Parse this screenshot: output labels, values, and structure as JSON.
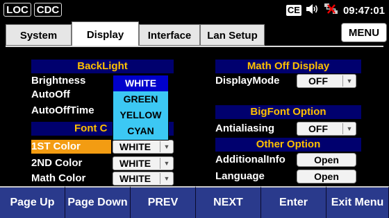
{
  "status": {
    "loc": "LOC",
    "cdc": "CDC",
    "ce_label": "CE",
    "time": "09:47:01",
    "icons": [
      "ce-indicator-icon",
      "speaker-icon",
      "lan-disconnected-icon"
    ]
  },
  "tabs": [
    {
      "label": "System"
    },
    {
      "label": "Display"
    },
    {
      "label": "Interface"
    },
    {
      "label": "Lan Setup"
    }
  ],
  "menu_label": "MENU",
  "left": {
    "backlight_header": "BackLight",
    "brightness_label": "Brightness",
    "autooff_label": "AutoOff",
    "autoofftime_label": "AutoOffTime",
    "font_color_header": "Font Color",
    "font_color_header_visible": "Font C",
    "first_color_label": "1ST Color",
    "first_color_value": "WHITE",
    "second_color_label": "2ND Color",
    "second_color_value": "WHITE",
    "math_color_label": "Math Color",
    "math_color_value": "WHITE"
  },
  "dropdown": {
    "options": [
      "WHITE",
      "GREEN",
      "YELLOW",
      "CYAN"
    ],
    "selected": "WHITE"
  },
  "right": {
    "math_off_header": "Math Off Display",
    "display_mode_label": "DisplayMode",
    "display_mode_value": "OFF",
    "bigfont_header": "BigFont Option",
    "antialiasing_label": "Antialiasing",
    "antialiasing_value": "OFF",
    "other_header": "Other Option",
    "additional_label": "AdditionalInfo",
    "additional_button": "Open",
    "language_label": "Language",
    "language_button": "Open"
  },
  "softkeys": [
    "Page Up",
    "Page Down",
    "PREV",
    "NEXT",
    "Enter",
    "Exit Menu"
  ],
  "colors": {
    "header_bg": "#00006e",
    "header_text": "#ffc000",
    "selected_row": "#f39c12",
    "dropdown_bg": "#3cc8f4",
    "dropdown_selected": "#0000cc",
    "softkey_bg": "#2a3a8c"
  }
}
